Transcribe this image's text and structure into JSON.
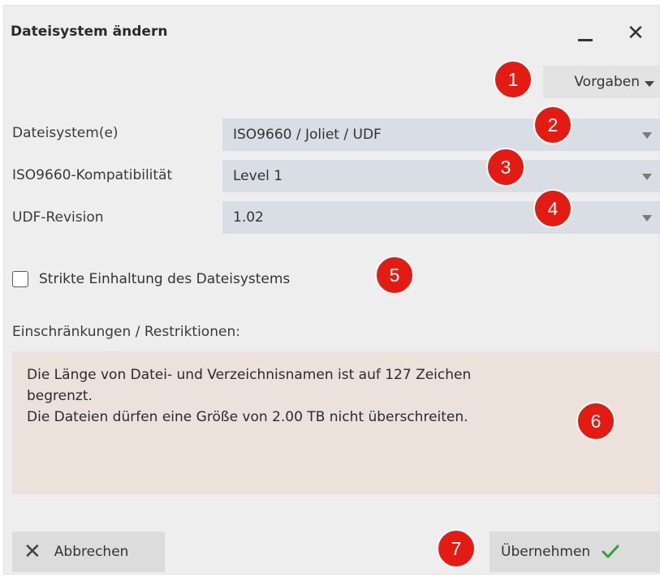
{
  "window": {
    "title": "Dateisystem ändern",
    "minimize_icon": "minimize-icon",
    "close_glyph": "✕"
  },
  "presets": {
    "label": "Vorgaben"
  },
  "fields": [
    {
      "label": "Dateisystem(e)",
      "value": "ISO9660 / Joliet / UDF"
    },
    {
      "label": "ISO9660-Kompatibilität",
      "value": "Level 1"
    },
    {
      "label": "UDF-Revision",
      "value": "1.02"
    }
  ],
  "strict": {
    "label": "Strikte Einhaltung des Dateisystems",
    "checked": false
  },
  "restrictions": {
    "label": "Einschränkungen / Restriktionen:",
    "line1": "Die Länge von Datei- und Verzeichnisnamen ist auf 127 Zeichen\nbegrenzt.",
    "line2": "Die Dateien dürfen eine Größe von 2.00 TB nicht überschreiten."
  },
  "buttons": {
    "cancel": "Abbrechen",
    "apply": "Übernehmen"
  },
  "callouts": [
    "1",
    "2",
    "3",
    "4",
    "5",
    "6",
    "7"
  ],
  "colors": {
    "callout": "#e31b12",
    "select_bg": "#d8dee4",
    "restrictions_bg": "#ece1db",
    "check": "#3a9a3a"
  }
}
